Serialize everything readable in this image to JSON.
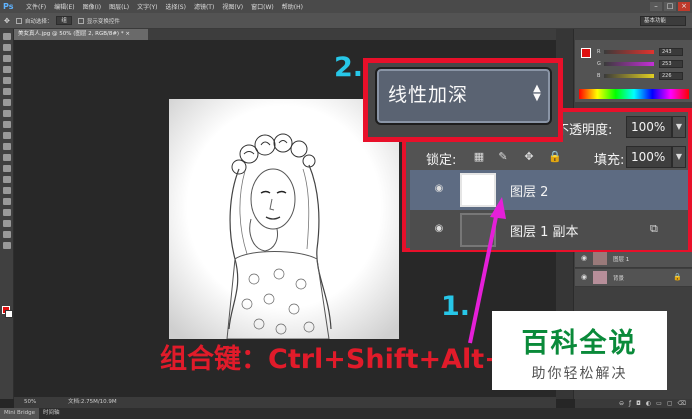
{
  "app": {
    "logo": "Ps",
    "menus": [
      "文件(F)",
      "编辑(E)",
      "图像(I)",
      "图层(L)",
      "文字(Y)",
      "选择(S)",
      "滤镜(T)",
      "视图(V)",
      "窗口(W)",
      "帮助(H)"
    ],
    "window_controls": [
      "–",
      "□",
      "×"
    ]
  },
  "options_bar": {
    "auto_select_label": "自动选择：",
    "auto_select_value": "组",
    "show_transform_label": "显示变换控件",
    "workspace": "基本功能"
  },
  "document": {
    "tab_title": "美女真人.jpg @ 50% (图层 2, RGB/8#) * ×",
    "zoom": "50%",
    "doc_size": "文档:2.75M/10.9M"
  },
  "color_panel": {
    "channels": [
      {
        "letter": "R",
        "value": "243",
        "color": "#e2332e"
      },
      {
        "letter": "G",
        "value": "253",
        "color": "#2e9e3e"
      },
      {
        "letter": "B",
        "value": "226",
        "color": "#2e52c8"
      }
    ]
  },
  "blend_mode": {
    "label": "线性加深",
    "arrows": "▲▼"
  },
  "layers_panel": {
    "opacity_label": "不透明度:",
    "opacity_value": "100%",
    "lock_label": "锁定:",
    "fill_label": "填充:",
    "fill_value": "100%",
    "layers": [
      {
        "name": "图层 2",
        "selected": true
      },
      {
        "name": "图层 1 副本",
        "selected": false
      }
    ],
    "small_layers": [
      {
        "name": "图层 1"
      },
      {
        "name": "背景"
      }
    ]
  },
  "annotations": {
    "step1": "1.",
    "step2": "2.",
    "combo": "组合键：Ctrl+Shift+Alt+E"
  },
  "watermark": {
    "title": "百科全说",
    "subtitle": "助你轻松解决"
  },
  "bottom_tabs": [
    "Mini Bridge",
    "时间轴"
  ],
  "colors": {
    "highlight_red": "#e8102a",
    "annotation_cyan": "#27c7e8",
    "arrow_magenta": "#e51fd8",
    "watermark_green": "#0a8a3a",
    "combo_red": "#e11b2a"
  }
}
